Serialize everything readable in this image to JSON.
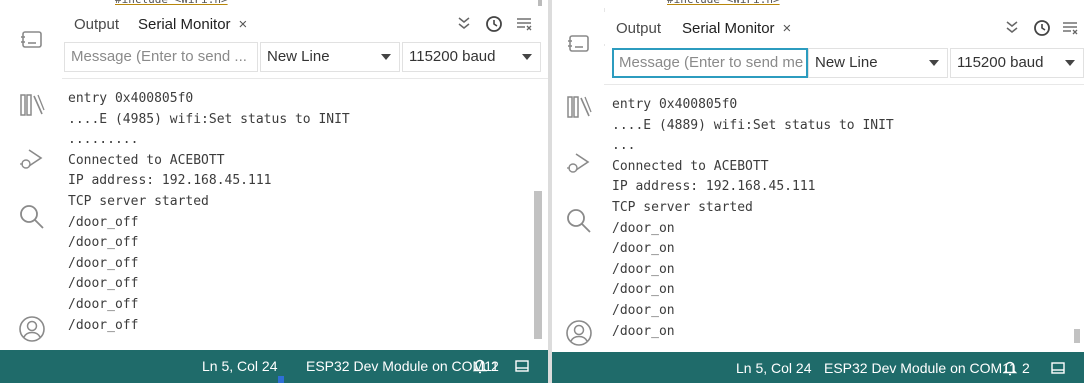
{
  "panels": [
    {
      "tabs": {
        "output": "Output",
        "serial_monitor": "Serial Monitor"
      },
      "message_placeholder": "Message (Enter to send ...",
      "line_ending": "New Line",
      "baud_rate": "115200 baud",
      "lines": [
        "entry 0x400805f0",
        "....E (4985) wifi:Set status to INIT",
        ".........",
        "Connected to ACEBOTT",
        "IP address: 192.168.45.111",
        "TCP server started",
        "/door_off",
        "/door_off",
        "/door_off",
        "/door_off",
        "/door_off",
        "/door_off"
      ],
      "status": {
        "position": "Ln 5, Col 24",
        "board": "ESP32 Dev Module on COM11",
        "notifications": "2"
      }
    },
    {
      "tabs": {
        "output": "Output",
        "serial_monitor": "Serial Monitor"
      },
      "message_placeholder": "Message (Enter to send me",
      "line_ending": "New Line",
      "baud_rate": "115200 baud",
      "lines": [
        "entry 0x400805f0",
        "....E (4889) wifi:Set status to INIT",
        "...",
        "Connected to ACEBOTT",
        "IP address: 192.168.45.111",
        "TCP server started",
        "/door_on",
        "/door_on",
        "/door_on",
        "/door_on",
        "/door_on",
        "/door_on"
      ],
      "status": {
        "position": "Ln 5, Col 24",
        "board": "ESP32 Dev Module on COM11",
        "notifications": "2"
      }
    }
  ],
  "colors": {
    "status_bar": "#1f6b6a",
    "focus_border": "#2c9cbf",
    "text": "#3c3c3c"
  },
  "icons": [
    "board-icon",
    "library-icon",
    "debug-icon",
    "search-icon",
    "account-icon",
    "toggle-timestamp-icon",
    "clock-icon",
    "clear-output-icon",
    "bell-icon",
    "panel-icon"
  ]
}
